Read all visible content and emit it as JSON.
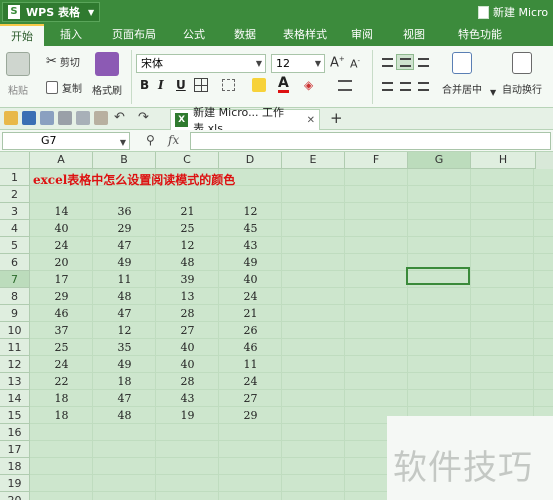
{
  "app": {
    "name": "WPS 表格",
    "doc_title": "新建 Micro"
  },
  "menu": {
    "tabs": [
      "开始",
      "插入",
      "页面布局",
      "公式",
      "数据",
      "表格样式",
      "审阅",
      "视图",
      "特色功能"
    ]
  },
  "ribbon": {
    "paste": "粘贴",
    "cut": "剪切",
    "copy": "复制",
    "format_painter": "格式刷",
    "font_name": "宋体",
    "font_size": "12",
    "bold": "B",
    "italic": "I",
    "underline": "U",
    "merge_center": "合并居中",
    "wrap_text": "自动换行"
  },
  "doc_tab": {
    "icon_text": "X",
    "label": "新建 Micro... 工作表.xls",
    "close": "✕",
    "add": "+"
  },
  "formula_bar": {
    "cell_ref": "G7",
    "fx": "fx"
  },
  "columns": [
    "A",
    "B",
    "C",
    "D",
    "E",
    "F",
    "G",
    "H"
  ],
  "selected_column": "G",
  "rows": [
    "1",
    "2",
    "3",
    "4",
    "5",
    "6",
    "7",
    "8",
    "9",
    "10",
    "11",
    "12",
    "13",
    "14",
    "15",
    "16",
    "17",
    "18",
    "19",
    "20"
  ],
  "selected_row": "7",
  "sheet": {
    "title": "excel表格中怎么设置阅读模式的颜色",
    "data": [
      [
        "14",
        "36",
        "21",
        "12"
      ],
      [
        "40",
        "29",
        "25",
        "45"
      ],
      [
        "24",
        "47",
        "12",
        "43"
      ],
      [
        "20",
        "49",
        "48",
        "49"
      ],
      [
        "17",
        "11",
        "39",
        "40"
      ],
      [
        "29",
        "48",
        "13",
        "24"
      ],
      [
        "46",
        "47",
        "28",
        "21"
      ],
      [
        "37",
        "12",
        "27",
        "26"
      ],
      [
        "25",
        "35",
        "40",
        "46"
      ],
      [
        "24",
        "49",
        "40",
        "11"
      ],
      [
        "22",
        "18",
        "28",
        "24"
      ],
      [
        "18",
        "47",
        "43",
        "27"
      ],
      [
        "18",
        "48",
        "19",
        "29"
      ]
    ]
  },
  "watermark": "软件技巧",
  "colors": {
    "brand": "#3c8b3c",
    "title_red": "#d11111",
    "reading_mode_green": "#cde6cd"
  }
}
